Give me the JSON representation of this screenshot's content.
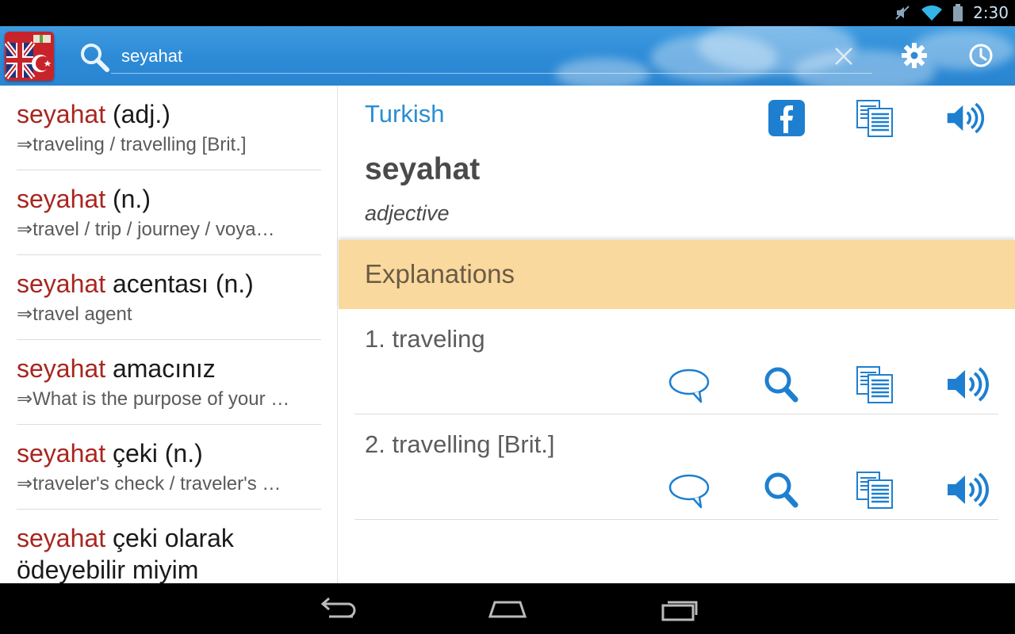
{
  "status_bar": {
    "time": "2:30",
    "icons": [
      "mute-icon",
      "wifi-icon",
      "battery-icon"
    ]
  },
  "action_bar": {
    "app_icon": "dictionary-flag-icon",
    "search": {
      "value": "seyahat",
      "placeholder": ""
    },
    "buttons": [
      "clear-icon",
      "settings-icon",
      "history-icon"
    ]
  },
  "results": [
    {
      "term": "seyahat",
      "rest": " (adj.)",
      "translation": "⇒traveling / travelling [Brit.]"
    },
    {
      "term": "seyahat",
      "rest": " (n.)",
      "translation": "⇒travel / trip / journey / voya…"
    },
    {
      "term": "seyahat",
      "rest": " acentası (n.)",
      "translation": "⇒travel agent"
    },
    {
      "term": "seyahat",
      "rest": " amacınız",
      "translation": "⇒What is the purpose of your …"
    },
    {
      "term": "seyahat",
      "rest": " çeki (n.)",
      "translation": "⇒traveler's check / traveler's …"
    },
    {
      "term": "seyahat",
      "rest": " çeki olarak",
      "rest2": "ödeyebilir miyim",
      "translation": ""
    }
  ],
  "detail": {
    "language": "Turkish",
    "word": "seyahat",
    "part_of_speech": "adjective",
    "section_title": "Explanations",
    "meanings": [
      {
        "text": "1. traveling"
      },
      {
        "text": "2. travelling [Brit.]"
      }
    ]
  },
  "colors": {
    "accent": "#2a8ed4",
    "highlight": "#a8261f",
    "section_bg": "#f9d99d"
  },
  "nav_bar": [
    "back-icon",
    "home-icon",
    "recents-icon"
  ]
}
